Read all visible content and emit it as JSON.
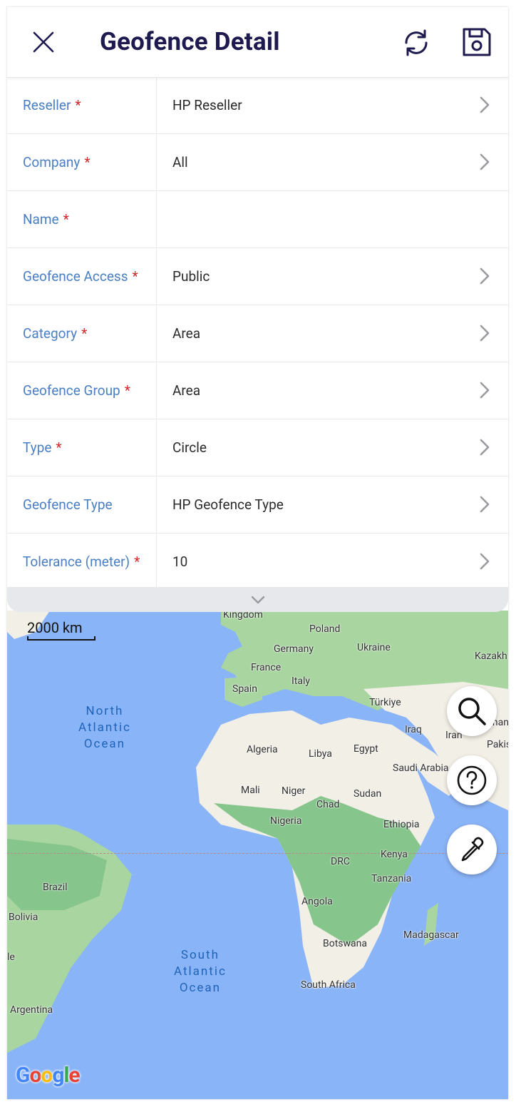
{
  "header": {
    "title": "Geofence Detail",
    "close_icon": "close-icon",
    "sync_icon": "sync-icon",
    "save_icon": "save-icon"
  },
  "form": {
    "rows": [
      {
        "label": "Reseller",
        "required": "*",
        "value": "HP Reseller"
      },
      {
        "label": "Company",
        "required": "*",
        "value": "All"
      },
      {
        "label": "Name",
        "required": "*",
        "value": ""
      },
      {
        "label": "Geofence Access",
        "required": "*",
        "value": "Public"
      },
      {
        "label": "Category",
        "required": "*",
        "value": "Area"
      },
      {
        "label": "Geofence Group",
        "required": "*",
        "value": "Area"
      },
      {
        "label": "Type",
        "required": "*",
        "value": "Circle"
      },
      {
        "label": "Geofence Type",
        "required": "",
        "value": "HP Geofence Type"
      },
      {
        "label": "Tolerance (meter)",
        "required": "*",
        "value": "10"
      }
    ]
  },
  "map": {
    "scale": "2000 km",
    "oceans": {
      "north_1": "North",
      "north_2": "Atlantic",
      "north_3": "Ocean",
      "south_1": "South",
      "south_2": "Atlantic",
      "south_3": "Ocean"
    },
    "labels": {
      "kingdom": "Kingdom",
      "poland": "Poland",
      "germany": "Germany",
      "ukraine": "Ukraine",
      "kazakh": "Kazakh",
      "france": "France",
      "italy": "Italy",
      "spain": "Spain",
      "turkiye": "Türkiye",
      "iraq": "Iraq",
      "iran": "Iran",
      "afghan": "ghan",
      "pakis": "Pakis",
      "algeria": "Algeria",
      "libya": "Libya",
      "egypt": "Egypt",
      "saudi": "Saudi Arabia",
      "mali": "Mali",
      "niger": "Niger",
      "sudan": "Sudan",
      "chad": "Chad",
      "nigeria": "Nigeria",
      "ethiopia": "Ethiopia",
      "kenya": "Kenya",
      "drc": "DRC",
      "tanzania": "Tanzania",
      "brazil": "Brazil",
      "bolivia": "Bolivia",
      "angola": "Angola",
      "madagascar": "Madagascar",
      "botswana": "Botswana",
      "chile": "le",
      "south_africa": "South Africa",
      "argentina": "Argentina"
    },
    "logo": "Google",
    "fab_icons": [
      "search-icon",
      "help-icon",
      "eyedropper-icon"
    ],
    "colors": {
      "water": "#8ab4f8",
      "land": "#f2efe6",
      "forest": "#86c58b"
    }
  }
}
